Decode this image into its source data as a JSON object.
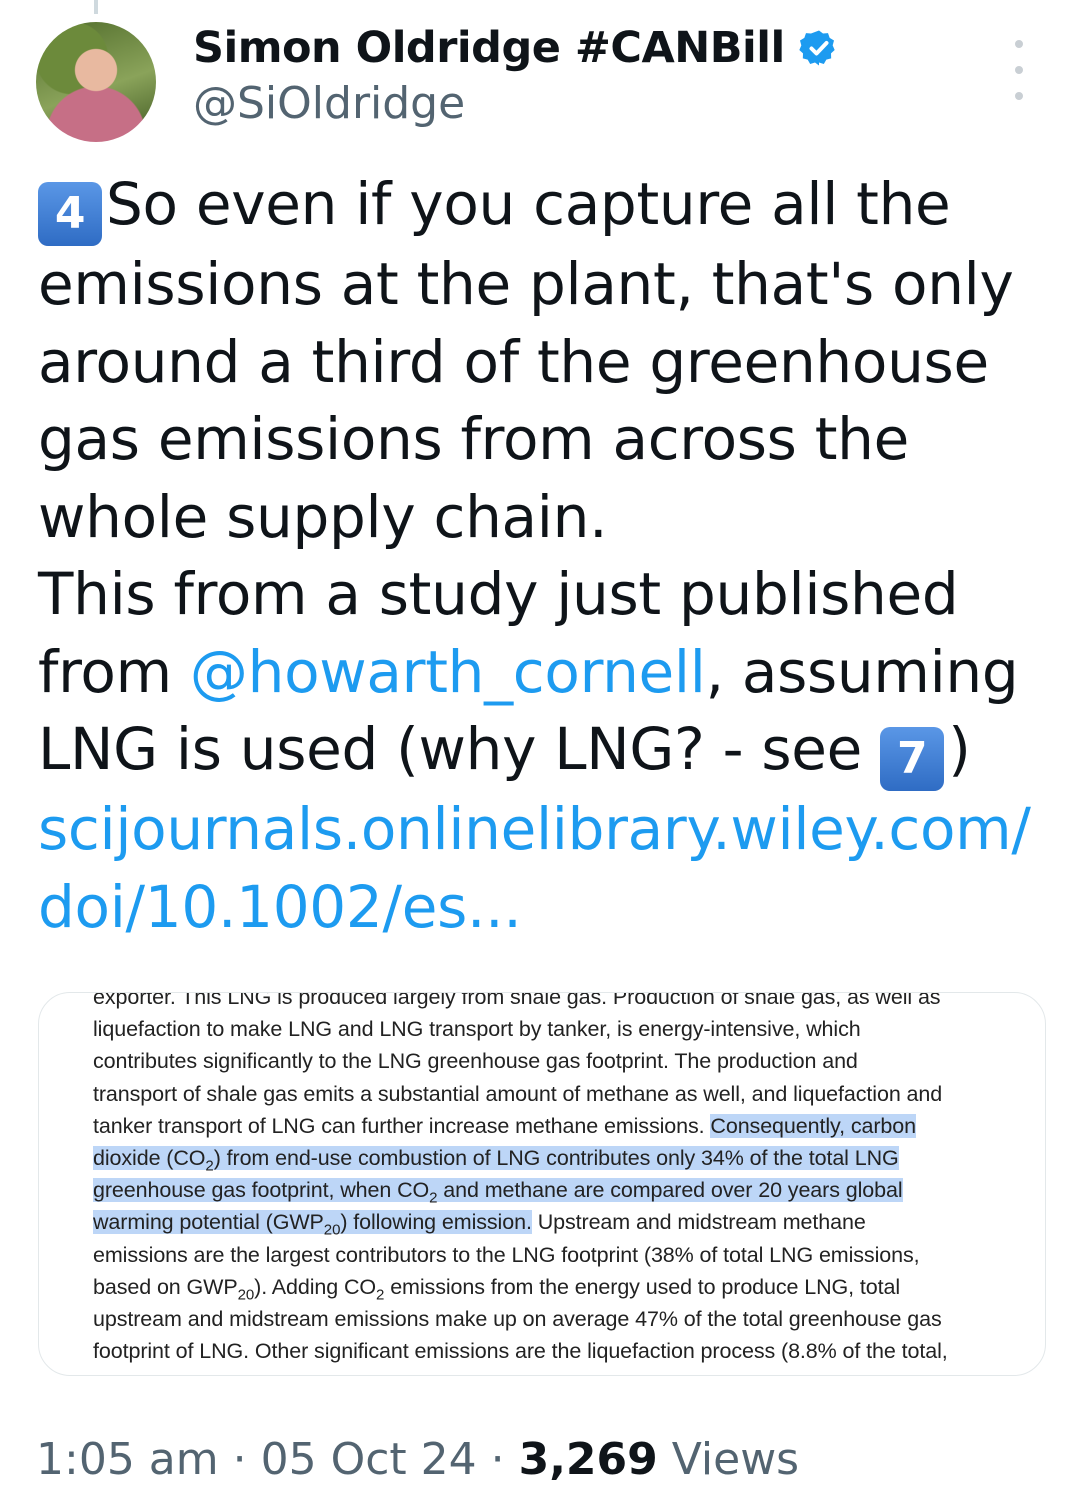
{
  "author": {
    "display_name": "Simon Oldridge #CANBill",
    "handle": "@SiOldridge",
    "verified": true
  },
  "tweet": {
    "keycap_4": "4",
    "p1": "So even if you capture all the emissions at the plant, that's only around a third of the greenhouse gas emissions from across the whole supply chain.",
    "p2_before": "This from a study just published from ",
    "mention": "@howarth_cornell",
    "p2_after": ", assuming LNG is used (why LNG? - see ",
    "keycap_7": "7",
    "p2_close": ")",
    "link": "scijournals.onlinelibrary.wiley.com/ doi/10.1002/es..."
  },
  "media_excerpt": {
    "l1": "exporter. This LNG is produced largely from shale gas. Production of shale gas, as well as",
    "l2": "liquefaction to make LNG and LNG transport by tanker, is energy-intensive, which",
    "l3": "contributes significantly to the LNG greenhouse gas footprint. The production and",
    "l4": "transport of shale gas emits a substantial amount of methane as well, and liquefaction and",
    "l5a": "tanker transport of LNG can further increase methane emissions. ",
    "l5b": "Consequently, carbon",
    "l6a": "dioxide (CO",
    "l6b": ") from end-use combustion of LNG contributes only 34% of the total LNG",
    "l7a": "greenhouse gas footprint, when CO",
    "l7b": " and methane are compared over 20 years global",
    "l8a": "warming potential (GWP",
    "l8b": ") following emission.",
    "l8c": " Upstream and midstream methane",
    "l9": "emissions are the largest contributors to the LNG footprint (38% of total LNG emissions,",
    "l10a": "based on GWP",
    "l10b": "). Adding CO",
    "l10c": " emissions from the energy used to produce LNG, total",
    "l11": "upstream and midstream emissions make up on average 47% of the total greenhouse gas",
    "l12": "footprint of LNG. Other significant emissions are the liquefaction process (8.8% of the total,",
    "sub2": "2",
    "sub20": "20"
  },
  "meta": {
    "time": "1:05 am",
    "sep": " · ",
    "date": "05 Oct 24",
    "views_count": "3,269",
    "views_label": " Views"
  },
  "colors": {
    "link": "#1d9bf0",
    "secondary_text": "#536471",
    "highlight": "#bdd6f7",
    "keycap": "#3a7bd5"
  },
  "icons": [
    "verified-badge-icon",
    "more-options-icon",
    "keycap-4-icon",
    "keycap-7-icon"
  ]
}
